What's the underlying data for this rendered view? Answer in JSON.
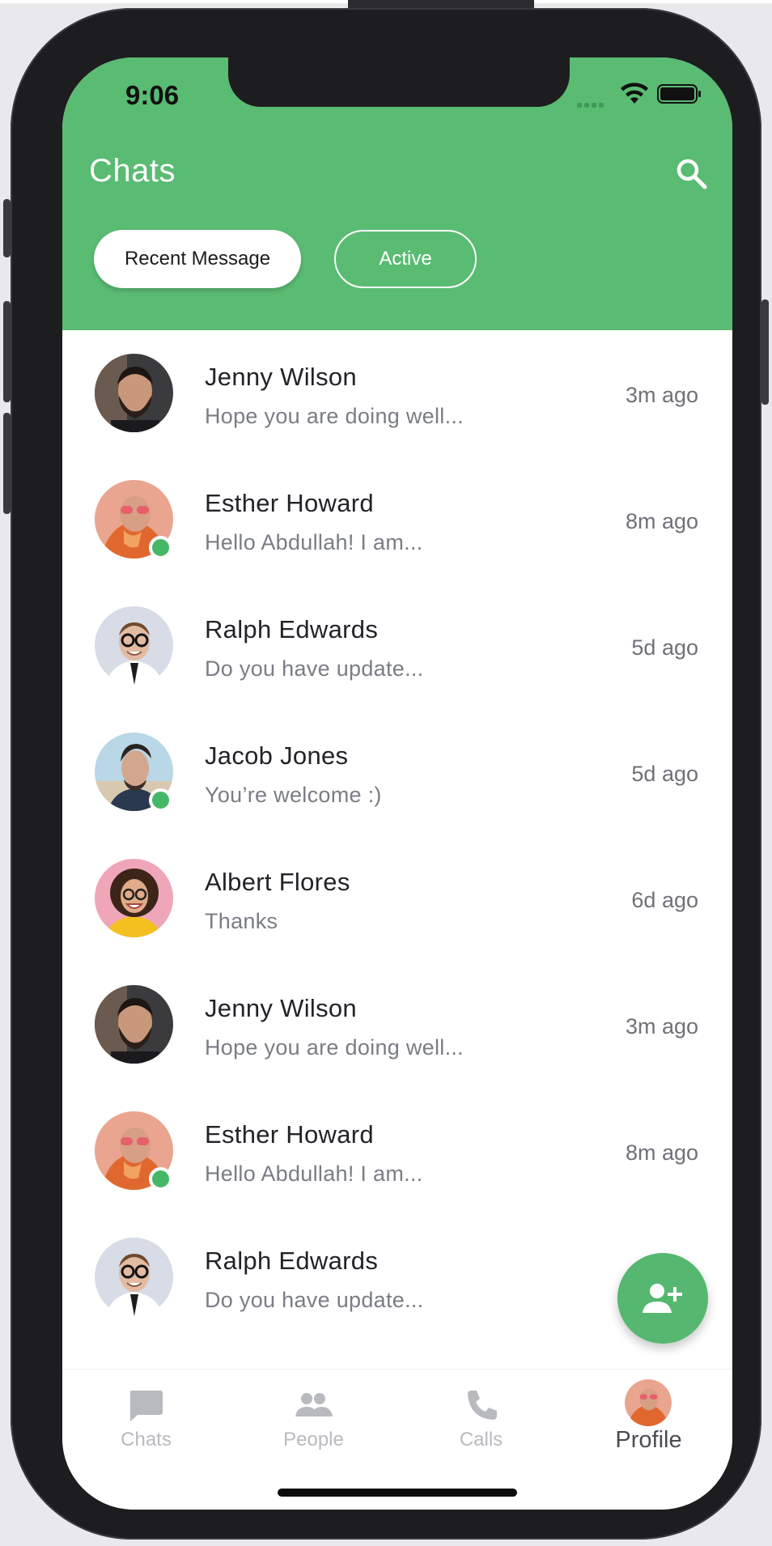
{
  "status_bar": {
    "time": "9:06"
  },
  "header": {
    "title": "Chats"
  },
  "filters": [
    {
      "label": "Recent Message"
    },
    {
      "label": "Active"
    }
  ],
  "chats": [
    {
      "name": "Jenny Wilson",
      "message": "Hope you are doing well...",
      "time": "3m ago",
      "online": false,
      "avatar": "bearded-man"
    },
    {
      "name": "Esther Howard",
      "message": "Hello Abdullah! I am...",
      "time": "8m ago",
      "online": true,
      "avatar": "orange-hood"
    },
    {
      "name": "Ralph Edwards",
      "message": "Do you have update...",
      "time": "5d ago",
      "online": false,
      "avatar": "glasses-man"
    },
    {
      "name": "Jacob Jones",
      "message": "You’re welcome :)",
      "time": "5d ago",
      "online": true,
      "avatar": "stylish-man"
    },
    {
      "name": "Albert Flores",
      "message": "Thanks",
      "time": "6d ago",
      "online": false,
      "avatar": "curly-woman"
    },
    {
      "name": "Jenny Wilson",
      "message": "Hope you are doing well...",
      "time": "3m ago",
      "online": false,
      "avatar": "bearded-man"
    },
    {
      "name": "Esther Howard",
      "message": "Hello Abdullah! I am...",
      "time": "8m ago",
      "online": true,
      "avatar": "orange-hood"
    },
    {
      "name": "Ralph Edwards",
      "message": "Do you have update...",
      "time": "",
      "online": false,
      "avatar": "glasses-man"
    }
  ],
  "bottom_nav": [
    {
      "label": "Chats",
      "icon": "chat-icon"
    },
    {
      "label": "People",
      "icon": "people-icon"
    },
    {
      "label": "Calls",
      "icon": "phone-icon"
    },
    {
      "label": "Profile",
      "icon": "profile-avatar"
    }
  ],
  "colors": {
    "primary": "#5abb73",
    "online": "#45b868",
    "text": "#222329",
    "muted": "#7a7d85"
  }
}
